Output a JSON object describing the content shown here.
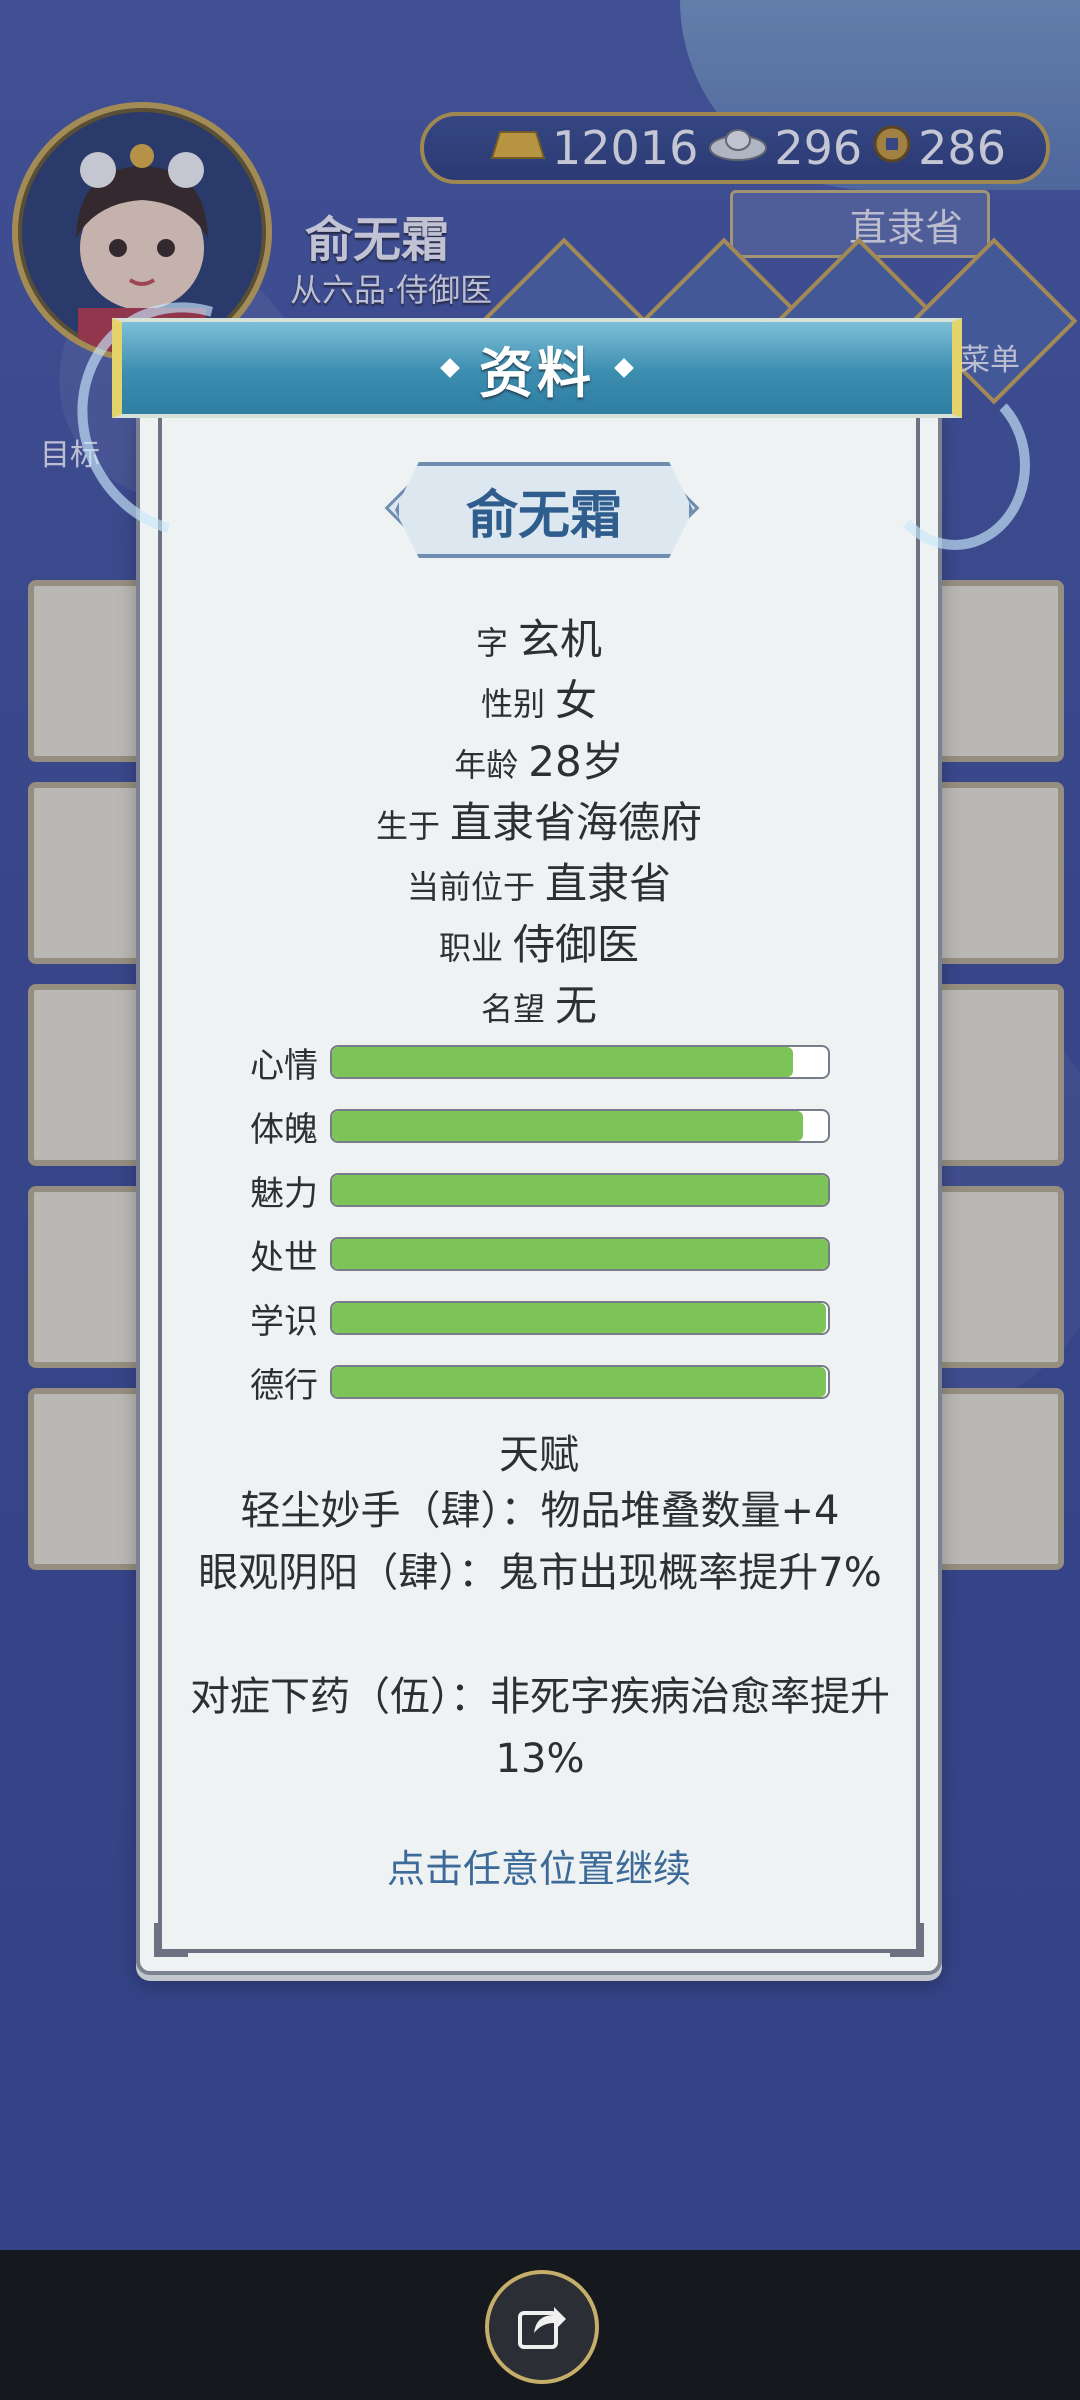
{
  "player": {
    "name": "俞无霜",
    "rank": "从六品·侍御医"
  },
  "resources": {
    "gold": "12016",
    "silver": "296",
    "coins": "286"
  },
  "location_button": "直隶省",
  "side_labels": {
    "target": "目标",
    "menu": "菜单"
  },
  "dialog": {
    "title": "资料",
    "name": "俞无霜",
    "info": [
      {
        "key": "字",
        "value": "玄机"
      },
      {
        "key": "性别",
        "value": "女"
      },
      {
        "key": "年龄",
        "value": "28岁"
      },
      {
        "key": "生于",
        "value": "直隶省海德府"
      },
      {
        "key": "当前位于",
        "value": "直隶省"
      },
      {
        "key": "职业",
        "value": "侍御医"
      },
      {
        "key": "名望",
        "value": "无"
      }
    ],
    "stats": [
      {
        "label": "心情",
        "fill": 0.93
      },
      {
        "label": "体魄",
        "fill": 0.95
      },
      {
        "label": "魅力",
        "fill": 1.0
      },
      {
        "label": "处世",
        "fill": 1.0
      },
      {
        "label": "学识",
        "fill": 0.995
      },
      {
        "label": "德行",
        "fill": 0.995
      }
    ],
    "talent_title": "天赋",
    "talents": [
      "轻尘妙手（肆）：物品堆叠数量+4",
      "眼观阴阳（肆）：鬼市出现概率提升7%",
      "对症下药（伍）：非死字疾病治愈率提升13%"
    ],
    "continue_hint": "点击任意位置继续"
  },
  "colors": {
    "stat_fill": "#7cc457",
    "title_bar": "#3c8db0",
    "accent_gold": "#c3a250"
  }
}
